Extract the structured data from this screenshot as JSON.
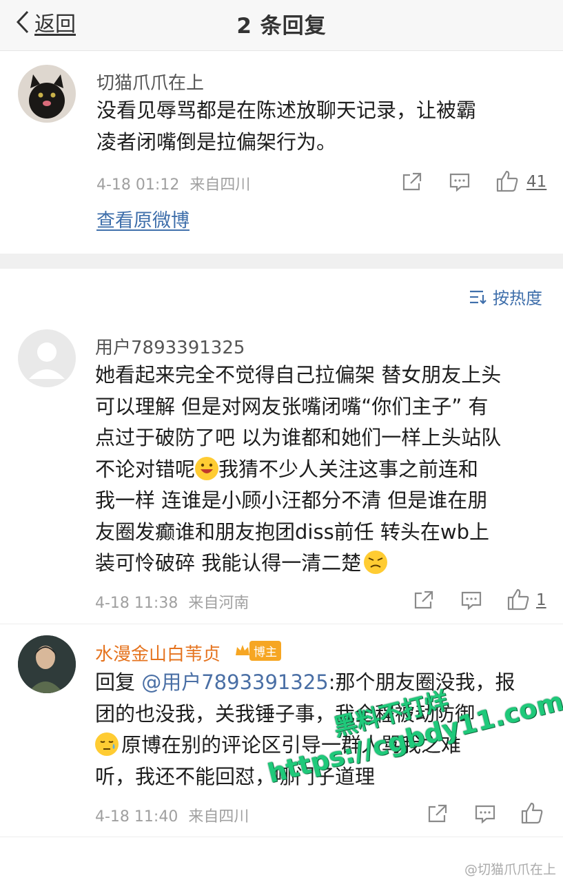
{
  "header": {
    "back_label": "返回",
    "title": "2 条回复"
  },
  "root_comment": {
    "username": "切猫爪爪在上",
    "text": "没看见辱骂都是在陈述放聊天记录，让被霸凌者闭嘴倒是拉偏架行为。",
    "line1": "没看见辱骂都是在陈述放聊天记录，让被霸",
    "line2": "凌者闭嘴倒是拉偏架行为。",
    "time": "4-18 01:12",
    "location": "来自四川",
    "likes": "41",
    "view_original": "查看原微博"
  },
  "sort_label": "按热度",
  "replies": [
    {
      "username": "用户7893391325",
      "lines": [
        "她看起来完全不觉得自己拉偏架 替女朋友上头",
        "可以理解 但是对网友张嘴闭嘴“你们主子” 有",
        "点过于破防了吧 以为谁都和她们一样上头站队",
        "不论对错呢",
        "我猜不少人关注这事之前连和",
        "我一样 连谁是小顾小汪都分不清 但是谁在朋",
        "友圈发癫谁和朋友抱团diss前任 转头在wb上",
        "装可怜破碎 我能认得一清二楚"
      ],
      "time": "4-18 11:38",
      "location": "来自河南",
      "likes": "1"
    },
    {
      "username": "水漫金山白苇贞",
      "badge": "博主",
      "reply_prefix": "回复 ",
      "mention": "@用户7893391325",
      "lines": [
        ":那个朋友圈没我，报",
        "团的也没我，关我锤子事，我全程被动防御",
        "原博在别的评论区引导一群人骂我之难",
        "听，我还不能回怼，哪门子道理"
      ],
      "time": "4-18 11:40",
      "location": "来自四川"
    }
  ],
  "watermark": {
    "line1": "黑料不打烊",
    "line2": "https://cgbdy11.com"
  },
  "footer_watermark": "@切猫爪爪在上",
  "colors": {
    "link": "#3f6fab",
    "gold_name": "#e5731e",
    "watermark": "#1fc97a"
  }
}
